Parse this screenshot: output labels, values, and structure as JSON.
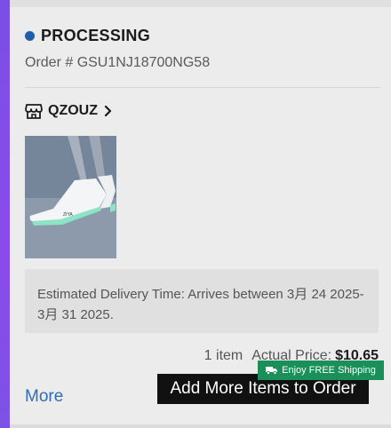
{
  "order": {
    "status": "PROCESSING",
    "order_number": "Order # GSU1NJ18700NG58",
    "store_name": "QZOUZ",
    "delivery_text": "Estimated Delivery Time: Arrives between 3月 24 2025-3月 31 2025.",
    "item_count": "1 item",
    "actual_price_label": "Actual Price:",
    "actual_price": "$10.65"
  },
  "actions": {
    "more_label": "More",
    "shipping_badge": "Enjoy FREE Shipping",
    "add_more_label": "Add More Items to Order"
  },
  "icons": {
    "store": "store-icon",
    "chevron": "chevron-right-icon",
    "truck": "truck-icon"
  },
  "colors": {
    "accent_stripe": "#8a4bea",
    "status_dot": "#1f5fa8",
    "link": "#2f6db3",
    "shipping_badge": "#1a8f5a",
    "button": "#111111"
  }
}
